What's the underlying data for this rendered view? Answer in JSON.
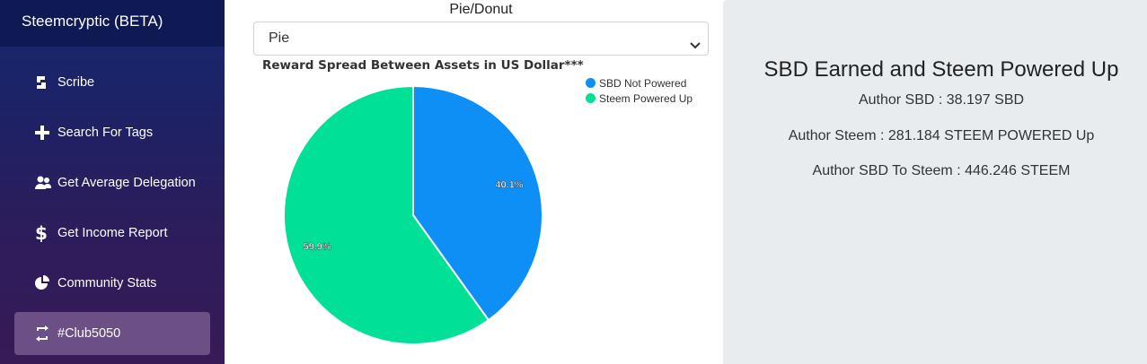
{
  "sidebar": {
    "brand": "Steemcryptic (BETA)",
    "items": [
      {
        "label": "Scribe",
        "icon": "scribe-icon"
      },
      {
        "label": "Search For Tags",
        "icon": "plus-icon"
      },
      {
        "label": "Get Average Delegation",
        "icon": "users-icon"
      },
      {
        "label": "Get Income Report",
        "icon": "dollar-icon"
      },
      {
        "label": "Community Stats",
        "icon": "pie-chart-icon"
      },
      {
        "label": "#Club5050",
        "icon": "retweet-icon",
        "active": true
      }
    ]
  },
  "chart_controls": {
    "select_label": "Pie/Donut",
    "selected": "Pie"
  },
  "chart_data": {
    "type": "pie",
    "title": "Reward Spread Between Assets in US Dollar***",
    "legend_position": "top-right",
    "slices": [
      {
        "name": "SBD Not Powered",
        "value": 40.1,
        "label": "40.1%",
        "color": "#0d8ff5"
      },
      {
        "name": "Steem Powered Up",
        "value": 59.9,
        "label": "59.9%",
        "color": "#00e096"
      }
    ]
  },
  "summary": {
    "title": "SBD Earned and Steem Powered Up",
    "author_sbd": "Author SBD : 38.197 SBD",
    "author_steem": "Author Steem : 281.184 STEEM POWERED Up",
    "author_sbd_to_steem": "Author SBD To Steem : 446.246 STEEM"
  }
}
